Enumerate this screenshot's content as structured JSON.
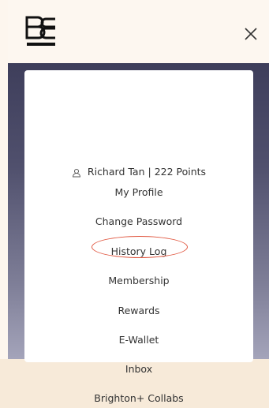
{
  "app": {
    "logo": "BC",
    "close_icon": "close-icon"
  },
  "user": {
    "name": "Richard Tan",
    "points": "222 Points",
    "separator": "|"
  },
  "menu": {
    "items": [
      {
        "label": "My Profile"
      },
      {
        "label": "Change Password"
      },
      {
        "label": "History Log"
      },
      {
        "label": "Membership"
      },
      {
        "label": "Rewards",
        "highlighted": true
      },
      {
        "label": "E-Wallet"
      },
      {
        "label": "Inbox"
      },
      {
        "label": "Brighton+ Collabs"
      }
    ]
  },
  "colors": {
    "highlight": "#e0553e",
    "overlay": "#4a4a66",
    "text": "#333333"
  }
}
